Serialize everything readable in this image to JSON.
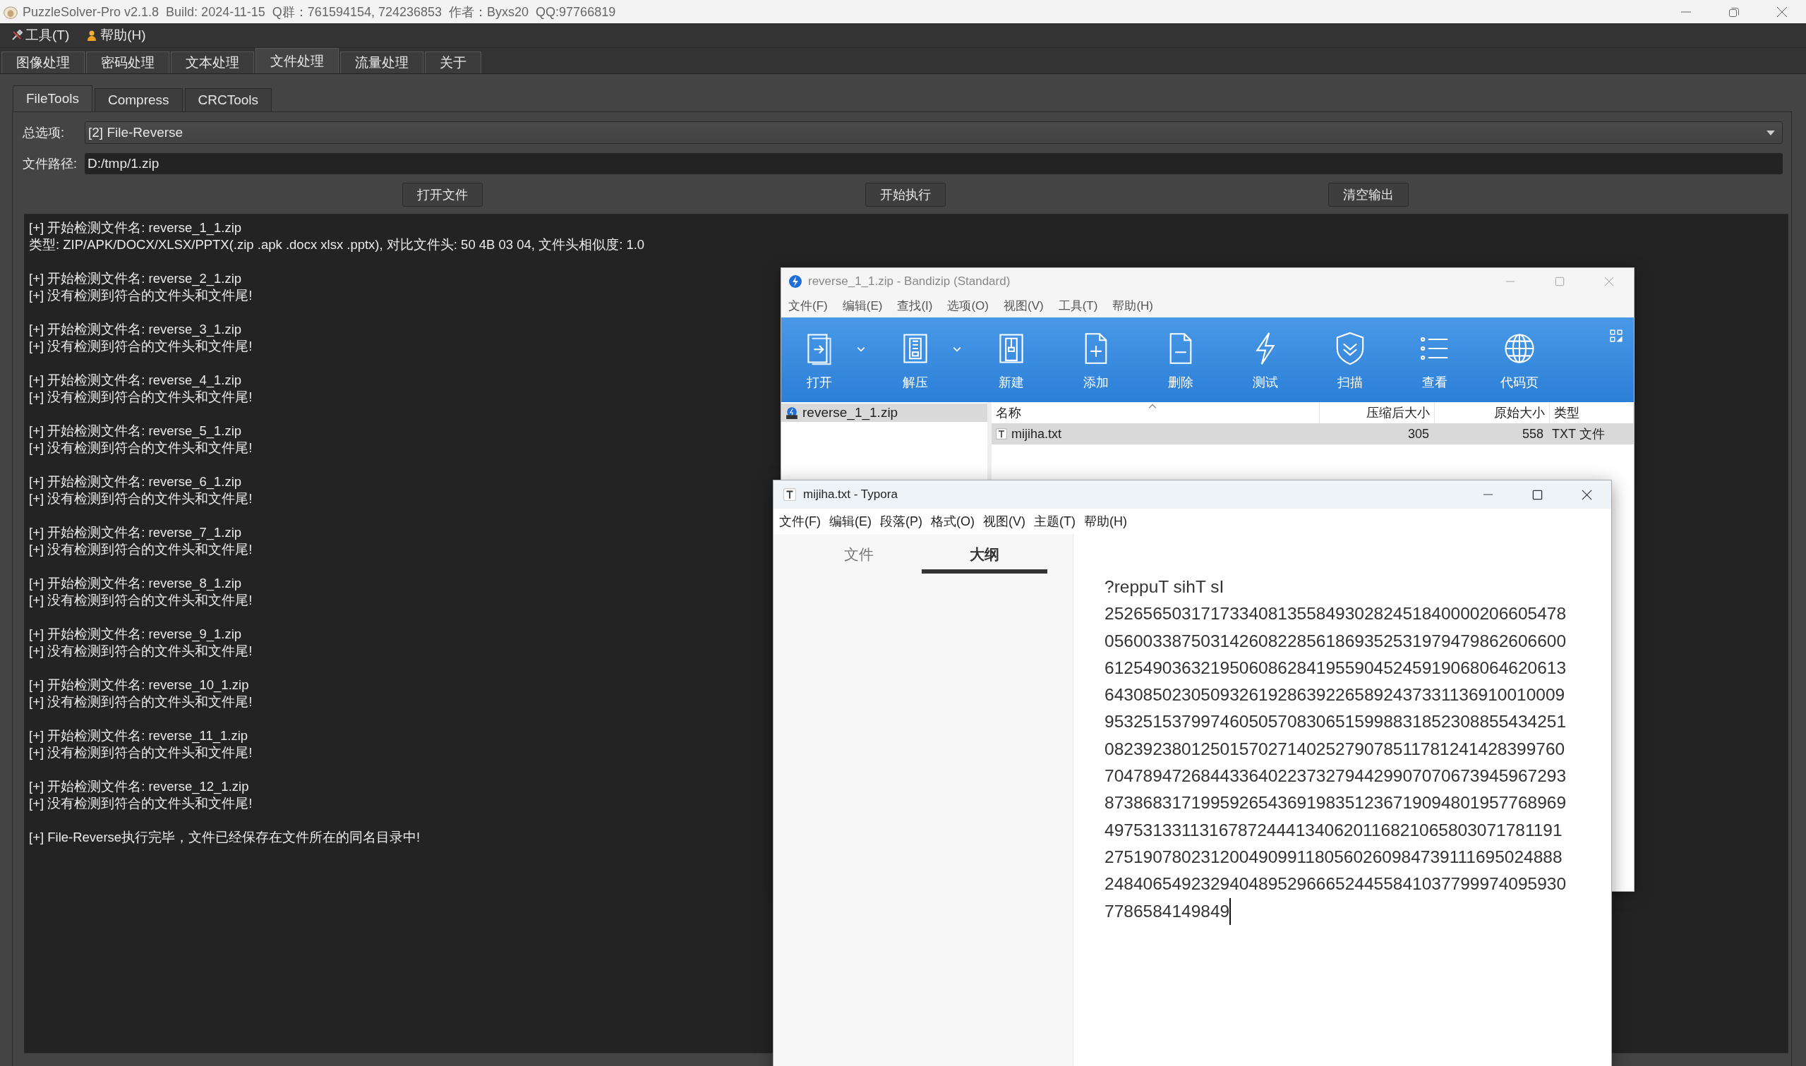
{
  "app": {
    "title": "PuzzleSolver-Pro v2.1.8  Build: 2024-11-15  Q群：761594154, 724236853  作者：Byxs20  QQ:97766819",
    "menu": [
      {
        "label": "工具(T)",
        "kind": "tools"
      },
      {
        "label": "帮助(H)",
        "kind": "help"
      }
    ],
    "tabs": [
      {
        "label": "图像处理",
        "selected": false
      },
      {
        "label": "密码处理",
        "selected": false
      },
      {
        "label": "文本处理",
        "selected": false
      },
      {
        "label": "文件处理",
        "selected": true
      },
      {
        "label": "流量处理",
        "selected": false
      },
      {
        "label": "关于",
        "selected": false
      }
    ],
    "subtabs": [
      {
        "label": "FileTools",
        "selected": true
      },
      {
        "label": "Compress",
        "selected": false
      },
      {
        "label": "CRCTools",
        "selected": false
      }
    ],
    "option": {
      "label": "总选项:",
      "value": "[2] File-Reverse"
    },
    "path": {
      "label": "文件路径:",
      "value": "D:/tmp/1.zip"
    },
    "buttons": [
      "打开文件",
      "开始执行",
      "清空输出"
    ],
    "output": [
      [
        "[+] 开始检测文件名: reverse_1_1.zip",
        "类型: ZIP/APK/DOCX/XLSX/PPTX(.zip .apk .docx xlsx .pptx), 对比文件头: 50 4B 03 04, 文件头相似度: 1.0"
      ],
      [
        "[+] 开始检测文件名: reverse_2_1.zip",
        "[+] 没有检测到符合的文件头和文件尾!"
      ],
      [
        "[+] 开始检测文件名: reverse_3_1.zip",
        "[+] 没有检测到符合的文件头和文件尾!"
      ],
      [
        "[+] 开始检测文件名: reverse_4_1.zip",
        "[+] 没有检测到符合的文件头和文件尾!"
      ],
      [
        "[+] 开始检测文件名: reverse_5_1.zip",
        "[+] 没有检测到符合的文件头和文件尾!"
      ],
      [
        "[+] 开始检测文件名: reverse_6_1.zip",
        "[+] 没有检测到符合的文件头和文件尾!"
      ],
      [
        "[+] 开始检测文件名: reverse_7_1.zip",
        "[+] 没有检测到符合的文件头和文件尾!"
      ],
      [
        "[+] 开始检测文件名: reverse_8_1.zip",
        "[+] 没有检测到符合的文件头和文件尾!"
      ],
      [
        "[+] 开始检测文件名: reverse_9_1.zip",
        "[+] 没有检测到符合的文件头和文件尾!"
      ],
      [
        "[+] 开始检测文件名: reverse_10_1.zip",
        "[+] 没有检测到符合的文件头和文件尾!"
      ],
      [
        "[+] 开始检测文件名: reverse_11_1.zip",
        "[+] 没有检测到符合的文件头和文件尾!"
      ],
      [
        "[+] 开始检测文件名: reverse_12_1.zip",
        "[+] 没有检测到符合的文件头和文件尾!"
      ],
      [
        "[+] File-Reverse执行完毕，文件已经保存在文件所在的同名目录中!"
      ]
    ]
  },
  "bandizip": {
    "title": "reverse_1_1.zip - Bandizip (Standard)",
    "menu": [
      "文件(F)",
      "编辑(E)",
      "查找(I)",
      "选项(O)",
      "视图(V)",
      "工具(T)",
      "帮助(H)"
    ],
    "toolbar": [
      {
        "label": "打开",
        "dropdown": true
      },
      {
        "label": "解压",
        "dropdown": true
      },
      {
        "label": "新建",
        "dropdown": false
      },
      {
        "label": "添加",
        "dropdown": false
      },
      {
        "label": "删除",
        "dropdown": false
      },
      {
        "label": "测试",
        "dropdown": false
      },
      {
        "label": "扫描",
        "dropdown": false
      },
      {
        "label": "查看",
        "dropdown": false
      },
      {
        "label": "代码页",
        "dropdown": false
      }
    ],
    "tree": [
      {
        "label": "reverse_1_1.zip",
        "selected": true
      }
    ],
    "columns": [
      "名称",
      "压缩后大小",
      "原始大小",
      "类型"
    ],
    "rows": [
      {
        "cells": [
          "mijiha.txt",
          "305",
          "558",
          "TXT 文件"
        ],
        "selected": true
      }
    ]
  },
  "typora": {
    "title": "mijiha.txt - Typora",
    "menu": [
      "文件(F)",
      "编辑(E)",
      "段落(P)",
      "格式(O)",
      "视图(V)",
      "主题(T)",
      "帮助(H)"
    ],
    "sidebar_tabs": [
      {
        "label": "文件",
        "selected": false
      },
      {
        "label": "大纲",
        "selected": true
      }
    ],
    "lines": [
      "?reppuT sihT sI",
      "252656503171733408135584930282451840000206605478",
      "056003387503142608228561869352531979479862606600",
      "612549036321950608628419559045245919068064620613",
      "643085023050932619286392265892437331136910010009",
      "953251537997460505708306515998831852308855434251",
      "082392380125015702714025279078511781241428399760",
      "704789472684433640223732794429907070673945967293",
      "873868317199592654369198351236719094801957768969",
      "497531331131678724441340620116821065803071781191",
      "275190780231200490991180560260984739111695024888",
      "248406549232940489529666524455841037799974095930",
      "7786584149849"
    ]
  }
}
